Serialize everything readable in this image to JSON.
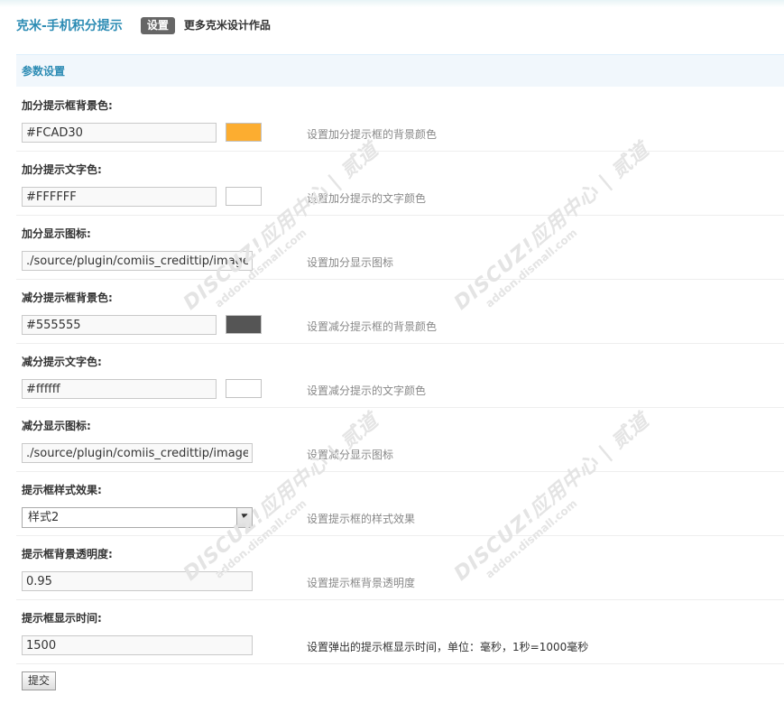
{
  "header": {
    "title": "克米-手机积分提示",
    "tabs": [
      {
        "label": "设置",
        "active": true
      },
      {
        "label": "更多克米设计作品",
        "active": false
      }
    ]
  },
  "section": {
    "title": "参数设置"
  },
  "settings": [
    {
      "label": "加分提示框背景色:",
      "value": "#FCAD30",
      "swatch": "#FCAD30",
      "description": "设置加分提示框的背景颜色"
    },
    {
      "label": "加分提示文字色:",
      "value": "#FFFFFF",
      "swatch": "#FFFFFF",
      "description": "设置加分提示的文字颜色"
    },
    {
      "label": "加分显示图标:",
      "value": "./source/plugin/comiis_credittip/image/c",
      "description": "设置加分显示图标"
    },
    {
      "label": "减分提示框背景色:",
      "value": "#555555",
      "swatch": "#555555",
      "description": "设置减分提示框的背景颜色"
    },
    {
      "label": "减分提示文字色:",
      "value": "#ffffff",
      "swatch": "#ffffff",
      "description": "设置减分提示的文字颜色"
    },
    {
      "label": "减分显示图标:",
      "value": "./source/plugin/comiis_credittip/image/c",
      "description": "设置减分显示图标"
    },
    {
      "label": "提示框样式效果:",
      "selected": "样式2",
      "description": "设置提示框的样式效果"
    },
    {
      "label": "提示框背景透明度:",
      "value": "0.95",
      "description": "设置提示框背景透明度"
    },
    {
      "label": "提示框显示时间:",
      "value": "1500",
      "description": "设置弹出的提示框显示时间，单位：毫秒，1秒=1000毫秒"
    }
  ],
  "submit": {
    "label": "提交"
  },
  "watermark": {
    "line1": "DISCUZ!应用中心 | 贰道",
    "line2": "addon.dismall.com"
  },
  "icons": {
    "select_arrow": "chevron-down-icon"
  }
}
